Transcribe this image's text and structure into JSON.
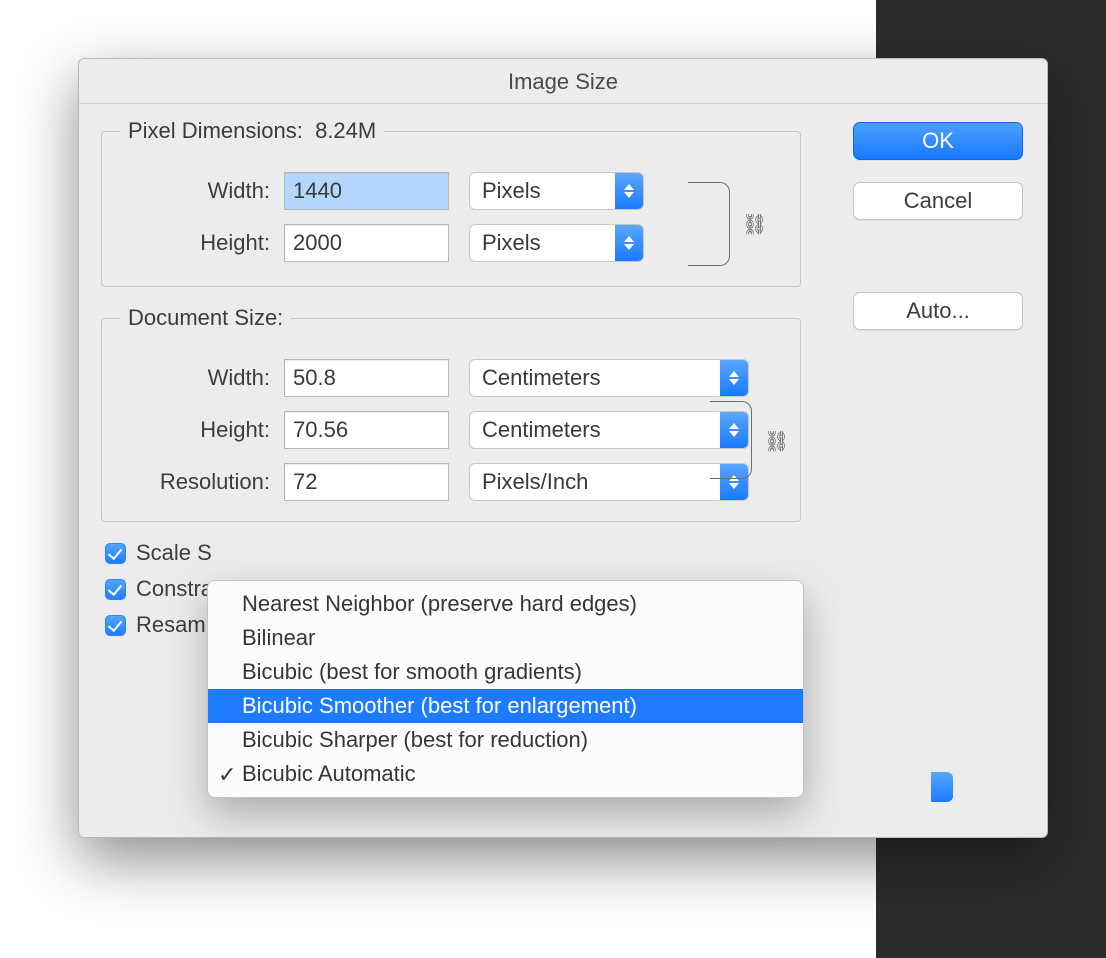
{
  "dialog": {
    "title": "Image Size",
    "buttons": {
      "ok": "OK",
      "cancel": "Cancel",
      "auto": "Auto..."
    }
  },
  "pixel_dimensions": {
    "legend_prefix": "Pixel Dimensions:",
    "size_readout": "8.24M",
    "width": {
      "label": "Width:",
      "value": "1440",
      "unit": "Pixels"
    },
    "height": {
      "label": "Height:",
      "value": "2000",
      "unit": "Pixels"
    }
  },
  "document_size": {
    "legend": "Document Size:",
    "width": {
      "label": "Width:",
      "value": "50.8",
      "unit": "Centimeters"
    },
    "height": {
      "label": "Height:",
      "value": "70.56",
      "unit": "Centimeters"
    },
    "resolution": {
      "label": "Resolution:",
      "value": "72",
      "unit": "Pixels/Inch"
    }
  },
  "checkboxes": {
    "scale_styles": {
      "label_visible": "Scale S",
      "checked": true
    },
    "constrain": {
      "label_visible": "Constra",
      "checked": true
    },
    "resample": {
      "label_visible": "Resam",
      "checked": true
    }
  },
  "resample_menu": {
    "options": [
      "Nearest Neighbor (preserve hard edges)",
      "Bilinear",
      "Bicubic (best for smooth gradients)",
      "Bicubic Smoother (best for enlargement)",
      "Bicubic Sharper (best for reduction)",
      "Bicubic Automatic"
    ],
    "highlighted_index": 3,
    "checked_index": 5
  }
}
